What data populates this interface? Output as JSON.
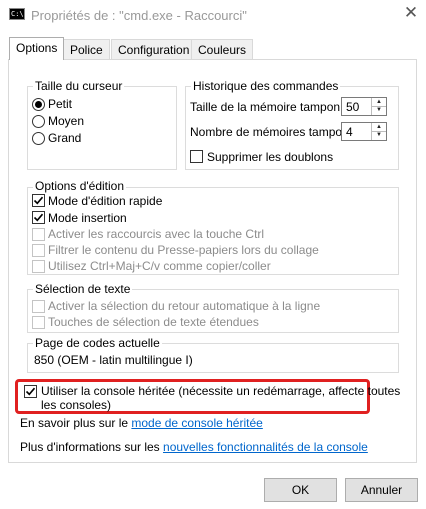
{
  "window": {
    "app_icon": "console-app-icon",
    "app_icon_text": "C:\\.",
    "title": "Propriétés de : \"cmd.exe - Raccourci\"",
    "close_glyph": "✕"
  },
  "tabs": [
    {
      "label": "Options",
      "active": true
    },
    {
      "label": "Police",
      "active": false
    },
    {
      "label": "Configuration",
      "active": false
    },
    {
      "label": "Couleurs",
      "active": false
    }
  ],
  "cursor_size": {
    "legend": "Taille du curseur",
    "options": [
      {
        "label": "Petit",
        "selected": true
      },
      {
        "label": "Moyen",
        "selected": false
      },
      {
        "label": "Grand",
        "selected": false
      }
    ]
  },
  "history": {
    "legend": "Historique des commandes",
    "buffer_size": {
      "label": "Taille de la mémoire tampon :",
      "value": "50"
    },
    "buffer_count": {
      "label": "Nombre de mémoires tampon :",
      "value": "4"
    },
    "discard_duplicates": {
      "label": "Supprimer les doublons",
      "checked": false
    }
  },
  "edit_options": {
    "legend": "Options d'édition",
    "items": [
      {
        "label": "Mode d'édition rapide",
        "checked": true,
        "enabled": true
      },
      {
        "label": "Mode insertion",
        "checked": true,
        "enabled": true
      },
      {
        "label": "Activer les raccourcis avec la touche Ctrl",
        "checked": false,
        "enabled": false
      },
      {
        "label": "Filtrer le contenu du Presse-papiers lors du collage",
        "checked": false,
        "enabled": false
      },
      {
        "label": "Utilisez Ctrl+Maj+C/v comme copier/coller",
        "checked": false,
        "enabled": false
      }
    ]
  },
  "text_selection": {
    "legend": "Sélection de texte",
    "items": [
      {
        "label": "Activer la sélection du retour automatique à la ligne",
        "checked": false,
        "enabled": false
      },
      {
        "label": "Touches de sélection de texte étendues",
        "checked": false,
        "enabled": false
      }
    ]
  },
  "codepage": {
    "legend": "Page de codes actuelle",
    "value": "850   (OEM - latin multilingue I)"
  },
  "legacy_console": {
    "label_line1": "Utiliser la console héritée (nécessite un redémarrage, affecte toutes",
    "label_line2": "les consoles)",
    "checked": true,
    "highlight_color": "#e02020"
  },
  "learn_more": {
    "prefix": "En savoir plus sur le ",
    "link": "mode de console héritée"
  },
  "more_info": {
    "prefix": "Plus d'informations sur les ",
    "link": "nouvelles fonctionnalités de la console"
  },
  "buttons": {
    "ok": "OK",
    "cancel": "Annuler"
  },
  "colors": {
    "link": "#0066cc",
    "highlight": "#e02020",
    "disabled_text": "#8c8c8c"
  }
}
